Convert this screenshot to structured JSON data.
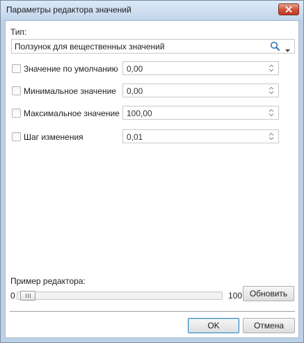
{
  "window": {
    "title": "Параметры редактора значений",
    "close_icon": "close-icon"
  },
  "type_section": {
    "label": "Тип:",
    "selected": "Ползунок для вещественных значений",
    "search_icon": "search-icon",
    "dropdown_icon": "chevron-down-icon"
  },
  "params": [
    {
      "label": "Значение по умолчанию",
      "checked": false,
      "value": "0,00"
    },
    {
      "label": "Минимальное значение",
      "checked": false,
      "value": "0,00"
    },
    {
      "label": "Максимальное значение",
      "checked": false,
      "value": "100,00"
    },
    {
      "label": "Шаг изменения",
      "checked": false,
      "value": "0,01"
    }
  ],
  "preview": {
    "label": "Пример редактора:",
    "min_label": "0",
    "max_label": "100",
    "slider_fraction": 0.0,
    "refresh_label": "Обновить"
  },
  "footer": {
    "ok_label": "OK",
    "cancel_label": "Отмена"
  },
  "colors": {
    "title_bar": "#c4d6ec",
    "close_button": "#d2553e",
    "primary_border": "#3c7fb1"
  }
}
